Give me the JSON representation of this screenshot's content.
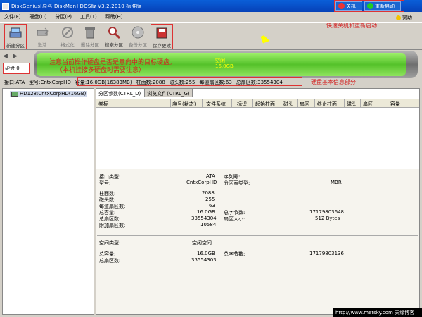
{
  "window": {
    "title": "DiskGenius[原名 DiskMan] DOS版 V3.2.2010 标准版",
    "shutdown_label": "关机",
    "restart_label": "重新启动",
    "help_label": "赞助"
  },
  "menu": [
    "文件(F)",
    "硬盘(D)",
    "分区(P)",
    "工具(T)",
    "帮助(H)"
  ],
  "toolbar": [
    {
      "label": "新建分区",
      "icon": "disk-new-icon",
      "highlight": true
    },
    {
      "label": "激活",
      "icon": "activate-icon"
    },
    {
      "label": "格式化",
      "icon": "format-icon"
    },
    {
      "label": "删除分区",
      "icon": "trash-icon"
    },
    {
      "label": "搜索分区",
      "icon": "magnifier-icon"
    },
    {
      "label": "备份分区",
      "icon": "backup-icon"
    },
    {
      "label": "保存更改",
      "icon": "save-icon",
      "highlight": true
    }
  ],
  "annotations": {
    "shutdown_note": "快速关机和重新启动",
    "warn_line1": "注意当前操作硬盘是否是意向中的目标硬盘。",
    "warn_line2": "（本机挂接多硬盘时需要注意）",
    "disk_info_note": "硬盘基本信息部分"
  },
  "disk_selector": "硬盘 0",
  "disk_bar": {
    "line1": "空闲",
    "line2": "16.0GB"
  },
  "disk_info": {
    "interface": "接口:ATA",
    "model": "型号:CntxCorpHD",
    "capacity": "容量:16.0GB(16383MB)",
    "cylinders": "柱面数:2088",
    "heads": "磁头数:255",
    "sectors_per_track": "每道扇区数:63",
    "total_sectors": "总扇区数:33554304"
  },
  "tree": {
    "node": "HD128:CntxCorpHD(16GB)"
  },
  "tabs": [
    "分区参数(CTRL_D)",
    "浏览文件(CTRL_G)"
  ],
  "grid_columns": [
    "卷标",
    "序号(状态)",
    "文件系统",
    "标识",
    "起始柱面",
    "磁头",
    "扇区",
    "终止柱面",
    "磁头",
    "扇区",
    "容量"
  ],
  "details": {
    "iface_label": "接口类型:",
    "iface_value": "ATA",
    "serial_label": "序列号:",
    "model_label": "型号:",
    "model_value": "CntxCorpHD",
    "ptable_label": "分区表类型:",
    "ptable_value": "MBR",
    "cyl_label": "柱面数:",
    "cyl_value": "2088",
    "heads_label": "磁头数:",
    "heads_value": "255",
    "spt_label": "每道扇区数:",
    "spt_value": "63",
    "cap_label": "总容量:",
    "cap_value": "16.0GB",
    "bytes_label": "总字节数:",
    "bytes_value": "17179803648",
    "tsec_label": "总扇区数:",
    "tsec_value": "33554304",
    "secsize_label": "扇区大小:",
    "secsize_value": "512 Bytes",
    "extra_label": "附加扇区数:",
    "extra_value": "10584",
    "space_label": "空间类型:",
    "space_value": "空闲空间",
    "scap_label": "总容量:",
    "scap_value": "16.0GB",
    "sbytes_label": "总字节数:",
    "sbytes_value": "17179803136",
    "ssec_label": "总扇区数:",
    "ssec_value": "33554303"
  },
  "watermark": "http://www.metsky.com  天缘博客"
}
